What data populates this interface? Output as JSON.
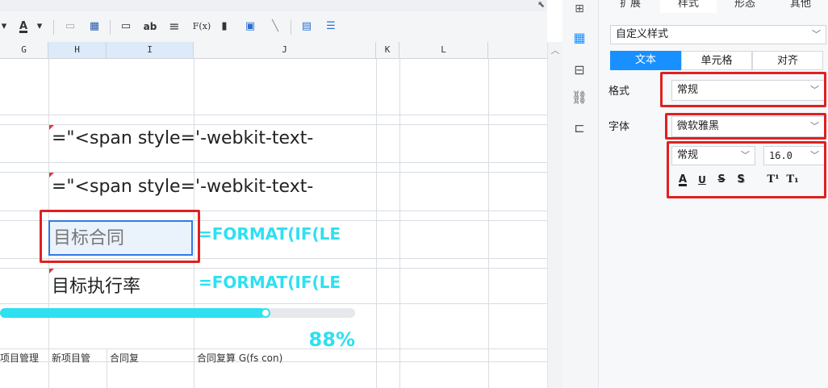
{
  "toolbar": {
    "font_color_button": "A",
    "dropdown_caret": "▾",
    "items": [
      {
        "name": "font-color-button",
        "glyph": "A"
      },
      {
        "name": "merge-cells-icon",
        "glyph": "▭"
      },
      {
        "name": "table-icon",
        "glyph": "▦"
      },
      {
        "name": "textbox-icon",
        "glyph": "▭"
      },
      {
        "name": "ab-text-icon",
        "glyph": "ab"
      },
      {
        "name": "align-icon",
        "glyph": "≡"
      },
      {
        "name": "formula-icon",
        "glyph": "F(x)"
      },
      {
        "name": "chart-icon",
        "glyph": "▮"
      },
      {
        "name": "image-icon",
        "glyph": "▣"
      },
      {
        "name": "slash-icon",
        "glyph": "╲"
      },
      {
        "name": "form-icon",
        "glyph": "▤"
      },
      {
        "name": "list-icon",
        "glyph": "☰"
      }
    ]
  },
  "columns": [
    "G",
    "H",
    "I",
    "J",
    "K",
    "L"
  ],
  "cells": {
    "h3": "=\"<span style='-webkit-text-",
    "h4": "=\"<span style='-webkit-text-",
    "h5": "目标合同",
    "j5": "=FORMAT(IF(LE",
    "h6": "目标执行率",
    "j6": "=FORMAT(IF(LE",
    "bottom_row": [
      "项目管理",
      "新项目管",
      "合同复",
      "合同复算 G(fs con)"
    ]
  },
  "progress": {
    "value": 0.88,
    "label": "88%"
  },
  "panel": {
    "tabs": [
      "扩展",
      "样式",
      "形态",
      "其他"
    ],
    "style_preset": "自定义样式",
    "segments": [
      "文本",
      "单元格",
      "对齐"
    ],
    "active_segment": "文本",
    "format_label": "格式",
    "format_value": "常规",
    "font_label": "字体",
    "font_value": "微软雅黑",
    "font_style_value": "常规",
    "font_size_value": "16.0",
    "format_buttons": [
      "A",
      "U",
      "S",
      "S",
      "T¹",
      "T₁"
    ]
  },
  "colors": {
    "accent": "#1890ff",
    "formula_cyan": "#2ee0f0",
    "highlight": "#e02020",
    "selected_cell_border": "#2f7be5"
  }
}
